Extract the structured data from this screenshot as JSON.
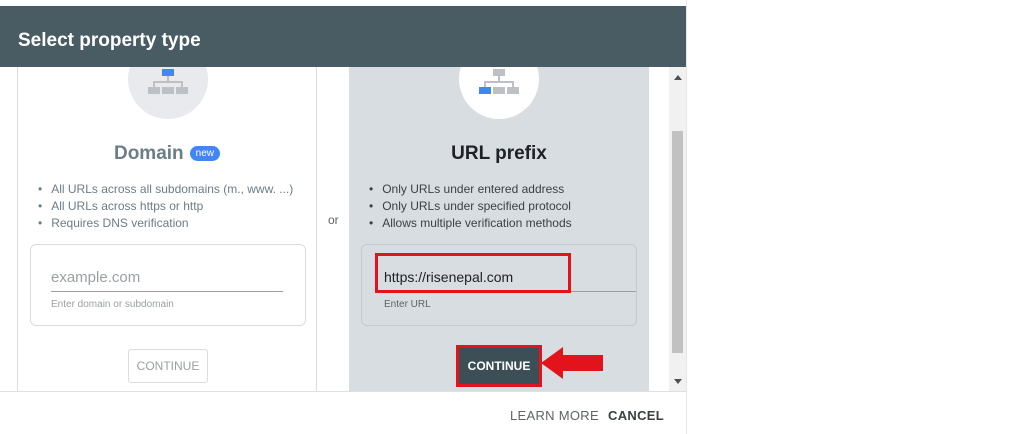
{
  "header": {
    "title": "Select property type"
  },
  "domain_panel": {
    "title": "Domain",
    "badge": "new",
    "features": [
      "All URLs across all subdomains (m., www. ...)",
      "All URLs across https or http",
      "Requires DNS verification"
    ],
    "input": {
      "placeholder": "example.com",
      "hint": "Enter domain or subdomain"
    },
    "continue_label": "CONTINUE"
  },
  "separator": "or",
  "url_prefix_panel": {
    "title": "URL prefix",
    "features": [
      "Only URLs under entered address",
      "Only URLs under specified protocol",
      "Allows multiple verification methods"
    ],
    "input": {
      "value": "https://risenepal.com",
      "hint": "Enter URL"
    },
    "continue_label": "CONTINUE"
  },
  "footer": {
    "learn_more": "LEARN MORE",
    "cancel": "CANCEL"
  },
  "icons": [
    "sitemap-icon",
    "sitemap-icon",
    "red-arrow-left-icon"
  ],
  "colors": {
    "header_bg": "#4a5c63",
    "accent_blue": "#4285f4",
    "highlight_red": "#e3131b",
    "selected_panel": "#d7dde1"
  }
}
